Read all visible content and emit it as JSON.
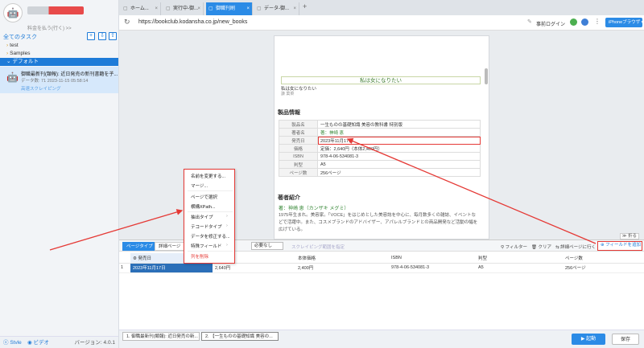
{
  "sidebar": {
    "promo": "料金を払う(行く) >>",
    "all_tasks": "全てのタスク",
    "tree": [
      {
        "label": "test"
      },
      {
        "label": "Samples"
      },
      {
        "label": "デフォルト"
      }
    ],
    "task": {
      "title": "御職最新刊(類報): 近日発売の新刊書籍を子...",
      "meta": "データ数: 71     2023-11-15 05:58:14",
      "tag": "高速スクレイピング"
    },
    "footer": {
      "link1": "Stvle",
      "link2": "ビデオ",
      "version": "バージョン: 4.0.1"
    }
  },
  "browser": {
    "tabs": [
      {
        "label": "ホーム..."
      },
      {
        "label": "実行中-御..."
      },
      {
        "label": "御職刊刷"
      },
      {
        "label": "データ-御..."
      }
    ],
    "url": "https://bookclub.kodansha.co.jp/new_books",
    "login": "事前ログイン",
    "mode": "iPhoneブラウザ ▾"
  },
  "page": {
    "book_alt": "私は女になりたい",
    "book_caption": "私は女になりたい",
    "book_author": "謙 菓菜",
    "product_heading": "製品情報",
    "product_info": [
      {
        "key": "製品名",
        "value": "一生ものの基礎知識 美容の教科書 特別版"
      },
      {
        "key": "著者名",
        "value": "著：神崎 恵"
      },
      {
        "key": "発売日",
        "value": "2023年11月17日"
      },
      {
        "key": "価格",
        "value": "定価：2,640円（本体2,400円）"
      },
      {
        "key": "ISBN",
        "value": "978-4-06-534081-3"
      },
      {
        "key": "判型",
        "value": "A5"
      },
      {
        "key": "ページ数",
        "value": "256ページ"
      }
    ],
    "author_heading": "著者紹介",
    "author_line": "著：神崎 恵（カンザキ メグミ）",
    "bio": "1975年生まれ。美容家。「VOCE」をはじめとした美容誌を中心に、毎月数多くの雑誌、イベントなどで活躍中。また、コスメブランドのアドバイザー、アパレルブランドとの商品開発など活動の幅を広げている。"
  },
  "context_menu": {
    "items": [
      {
        "label": "名前を変更する..."
      },
      {
        "label": "マージ..."
      },
      {
        "label": "ページで選択"
      },
      {
        "label": "横構XPath..."
      },
      {
        "label": "抽出タイプ",
        "submenu": true
      },
      {
        "label": "テコードタイプ",
        "submenu": true
      },
      {
        "label": "データを修正する..."
      },
      {
        "label": "特殊フィールド",
        "submenu": true
      }
    ],
    "delete": "列を削除"
  },
  "panel": {
    "collapse": "≫ 折る",
    "tabs": {
      "list": "ページタイプ",
      "detail": "詳細ページ"
    },
    "select_value": "必要なし",
    "scrape_range": "スクレイピング範囲を指定",
    "tools": {
      "filter": "フィルター",
      "clear": "クリア",
      "goto_detail": "詳細ページに行く"
    },
    "add_field": "フィールドを追加",
    "columns": [
      "",
      "発売日",
      "",
      "本体価格",
      "ISBN",
      "判型",
      "ページ数"
    ],
    "rows": [
      [
        "1",
        "2023年11月17日",
        "2,640円",
        "2,400円",
        "978-4-06-534081-3",
        "A5",
        "256ページ"
      ]
    ]
  },
  "bottom": {
    "tabs": [
      {
        "label": "1. 御職最新刊(類報): 近日発売の新..."
      },
      {
        "label": "2. 【一生ものの基礎知識 美容の..."
      }
    ],
    "run": "▶ 起動",
    "save": "保存"
  },
  "colors": {
    "accent": "#2b8be6",
    "highlight": "#e53935"
  }
}
